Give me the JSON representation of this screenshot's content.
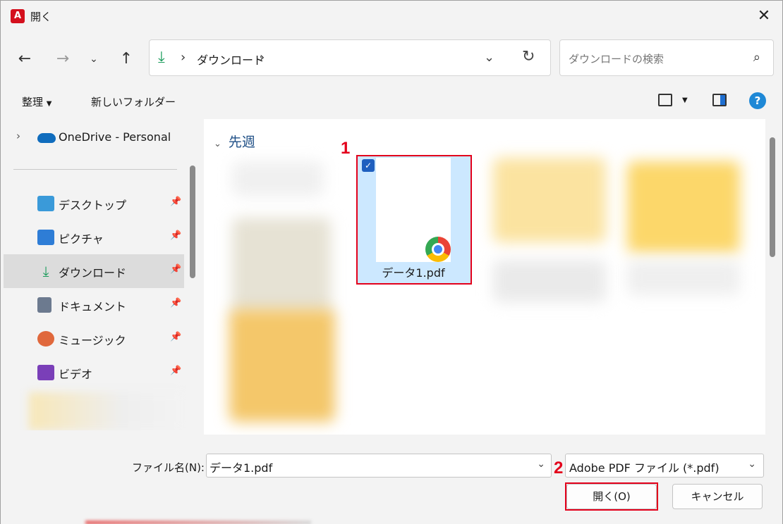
{
  "window": {
    "title": "開く",
    "app_icon_glyph": "A"
  },
  "nav": {
    "path_segment": "ダウンロード",
    "search_placeholder": "ダウンロードの検索"
  },
  "toolbar": {
    "organize": "整理",
    "new_folder": "新しいフォルダー",
    "help": "?"
  },
  "sidebar": {
    "onedrive": "OneDrive - Personal",
    "items": [
      {
        "label": "デスクトップ",
        "icon": "desktop-icon",
        "color": "#3a9ad9"
      },
      {
        "label": "ピクチャ",
        "icon": "pictures-icon",
        "color": "#2e7dd6"
      },
      {
        "label": "ダウンロード",
        "icon": "download-icon",
        "color": "#1a9b5b",
        "selected": true
      },
      {
        "label": "ドキュメント",
        "icon": "documents-icon",
        "color": "#6c7a8f"
      },
      {
        "label": "ミュージック",
        "icon": "music-icon",
        "color": "#e0683c"
      },
      {
        "label": "ビデオ",
        "icon": "video-icon",
        "color": "#7a3fb8"
      }
    ]
  },
  "content": {
    "group_title": "先週",
    "selected_file": "データ1.pdf"
  },
  "annotations": {
    "step1": "1",
    "step2": "2"
  },
  "bottom": {
    "filename_label": "ファイル名(N):",
    "filename_value": "データ1.pdf",
    "filetype_value": "Adobe PDF ファイル (*.pdf)",
    "open_button": "開く(O)",
    "cancel_button": "キャンセル"
  }
}
